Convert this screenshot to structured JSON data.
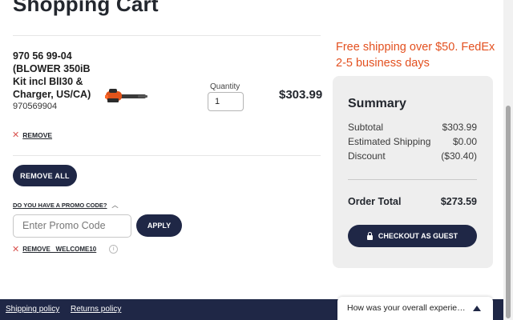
{
  "page": {
    "title": "Shopping Cart"
  },
  "cart_item": {
    "name": "970 56 99-04 (BLOWER 350iB Kit incl BlI30 & Charger, US/CA)",
    "sku": "970569904",
    "quantity_label": "Quantity",
    "quantity_value": "1",
    "price": "$303.99",
    "remove_label": "REMOVE",
    "image_icon": "leaf-blower-product-image"
  },
  "actions": {
    "remove_all_label": "REMOVE ALL"
  },
  "promo": {
    "toggle_label": "DO YOU HAVE A PROMO CODE?",
    "placeholder": "Enter Promo Code",
    "apply_label": "APPLY",
    "applied_code_label": "REMOVE   WELCOME10"
  },
  "shipping_message": "Free shipping over $50. FedEx 2-5 business days",
  "summary": {
    "title": "Summary",
    "rows": [
      {
        "label": "Subtotal",
        "value": "$303.99"
      },
      {
        "label": "Estimated Shipping",
        "value": "$0.00"
      },
      {
        "label": "Discount",
        "value": "($30.40)"
      }
    ],
    "total_label": "Order Total",
    "total_value": "$273.59",
    "checkout_label": "CHECKOUT AS GUEST"
  },
  "footer": {
    "links": [
      "Shipping policy",
      "Returns policy"
    ],
    "feedback_label": "How was your overall experien..."
  },
  "colors": {
    "brand_navy": "#1f2746",
    "promo_orange": "#e3501f",
    "panel_gray": "#eeeeee",
    "remove_red": "#d9534f"
  }
}
